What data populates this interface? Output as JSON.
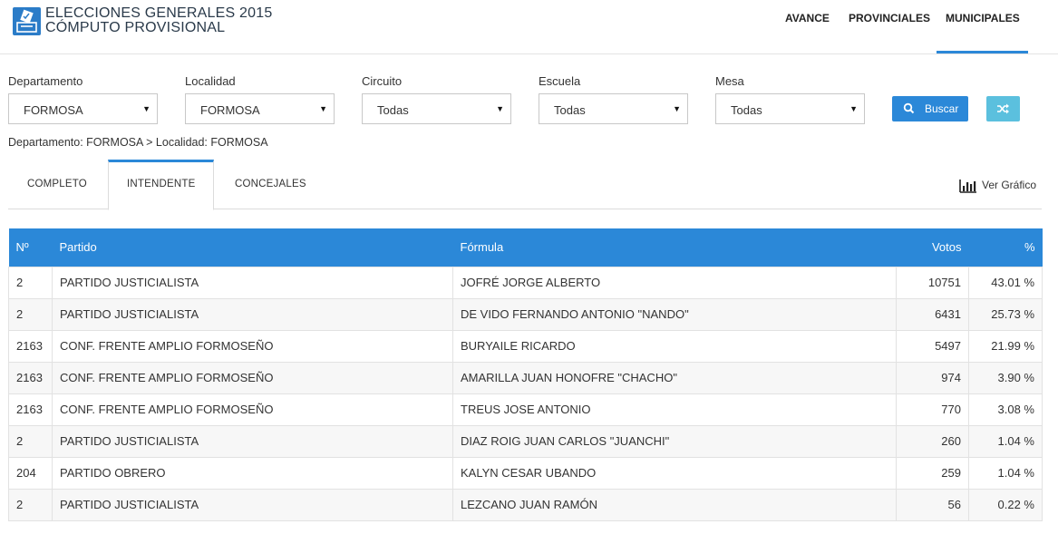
{
  "header": {
    "title_line1": "ELECCIONES GENERALES 2015",
    "title_line2": "CÓMPUTO PROVISIONAL",
    "logo_icon": "ballot-box-icon",
    "nav": [
      "AVANCE",
      "PROVINCIALES",
      "MUNICIPALES"
    ],
    "active_nav": "MUNICIPALES"
  },
  "filters": {
    "departamento": {
      "label": "Departamento",
      "value": "FORMOSA"
    },
    "localidad": {
      "label": "Localidad",
      "value": "FORMOSA"
    },
    "circuito": {
      "label": "Circuito",
      "value": "Todas"
    },
    "escuela": {
      "label": "Escuela",
      "value": "Todas"
    },
    "mesa": {
      "label": "Mesa",
      "value": "Todas"
    },
    "buscar_label": "Buscar",
    "shuffle_icon": "shuffle-icon"
  },
  "breadcrumb": "Departamento: FORMOSA > Localidad: FORMOSA",
  "tabs": [
    "COMPLETO",
    "INTENDENTE",
    "CONCEJALES"
  ],
  "active_tab": "INTENDENTE",
  "ver_grafico": "Ver Gráfico",
  "colors": {
    "accent": "#2b88d8",
    "shuffle": "#5bc0de",
    "logo": "#2b7cc8"
  },
  "table": {
    "headers": [
      "Nº",
      "Partido",
      "Fórmula",
      "Votos",
      "%"
    ],
    "rows": [
      {
        "n": "2",
        "partido": "PARTIDO JUSTICIALISTA",
        "formula": "JOFRÉ JORGE ALBERTO",
        "votos": "10751",
        "pct": "43.01 %"
      },
      {
        "n": "2",
        "partido": "PARTIDO JUSTICIALISTA",
        "formula": "DE VIDO FERNANDO ANTONIO \"NANDO\"",
        "votos": "6431",
        "pct": "25.73 %"
      },
      {
        "n": "2163",
        "partido": "CONF. FRENTE AMPLIO FORMOSEÑO",
        "formula": "BURYAILE RICARDO",
        "votos": "5497",
        "pct": "21.99 %"
      },
      {
        "n": "2163",
        "partido": "CONF. FRENTE AMPLIO FORMOSEÑO",
        "formula": "AMARILLA JUAN HONOFRE \"CHACHO\"",
        "votos": "974",
        "pct": "3.90 %"
      },
      {
        "n": "2163",
        "partido": "CONF. FRENTE AMPLIO FORMOSEÑO",
        "formula": "TREUS JOSE ANTONIO",
        "votos": "770",
        "pct": "3.08 %"
      },
      {
        "n": "2",
        "partido": "PARTIDO JUSTICIALISTA",
        "formula": "DIAZ ROIG JUAN CARLOS \"JUANCHI\"",
        "votos": "260",
        "pct": "1.04 %"
      },
      {
        "n": "204",
        "partido": "PARTIDO OBRERO",
        "formula": "KALYN CESAR UBANDO",
        "votos": "259",
        "pct": "1.04 %"
      },
      {
        "n": "2",
        "partido": "PARTIDO JUSTICIALISTA",
        "formula": "LEZCANO JUAN RAMÓN",
        "votos": "56",
        "pct": "0.22 %"
      }
    ]
  }
}
